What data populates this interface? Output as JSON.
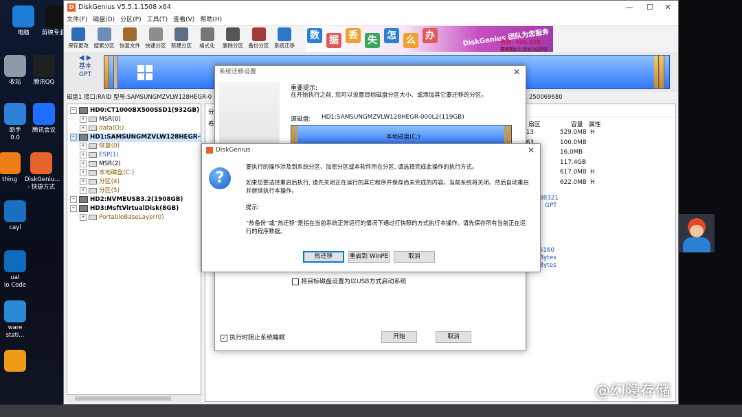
{
  "desktop": {
    "left_icons": [
      {
        "label": "电脑",
        "icon": "computer-icon",
        "color": "#1d7ed8"
      },
      {
        "label": "剪映专业版",
        "icon": "capcut-icon",
        "color": "#111111"
      },
      {
        "label": "收站",
        "icon": "recycle-bin-icon",
        "color": "#8f9aa8"
      },
      {
        "label": "腾讯QQ",
        "icon": "qq-icon",
        "color": "#202020"
      },
      {
        "label": "助手\n0.0",
        "icon": "assistant-icon",
        "color": "#2d7fd9"
      },
      {
        "label": "腾讯会议",
        "icon": "tencent-meeting-icon",
        "color": "#1e6fff"
      },
      {
        "label": "thing",
        "icon": "everything-icon",
        "color": "#f07c18"
      },
      {
        "label": "DiskGeniu...\n- 快捷方式",
        "icon": "diskgenius-icon",
        "color": "#e8632b"
      },
      {
        "label": "cayl",
        "icon": "app-icon",
        "color": "#1b6fc2"
      },
      {
        "label": "ual\nio Code",
        "icon": "vscode-icon",
        "color": "#0f6cbd"
      },
      {
        "label": "ware\nstati...",
        "icon": "vmware-icon",
        "color": "#2a8ad6"
      },
      {
        "label": "",
        "icon": "folder-icon",
        "color": "#f09a19"
      }
    ]
  },
  "app": {
    "title": "DiskGenius V5.5.1.1508 x64",
    "logo": "D",
    "window_controls": {
      "minimize": "—",
      "maximize": "☐",
      "close": "✕"
    },
    "menu": [
      "文件(F)",
      "磁盘(D)",
      "分区(P)",
      "工具(T)",
      "查看(V)",
      "帮助(H)"
    ],
    "toolbar": [
      {
        "label": "保存更改",
        "color": "#2f6db5"
      },
      {
        "label": "搜索分区",
        "color": "#6b8fb9"
      },
      {
        "label": "恢复文件",
        "color": "#a36b2b"
      },
      {
        "label": "快速分区",
        "color": "#8d8d8d"
      },
      {
        "label": "新建分区",
        "color": "#5c6f85"
      },
      {
        "label": "格式化",
        "color": "#777777"
      },
      {
        "label": "删除分区",
        "color": "#555555"
      },
      {
        "label": "备份分区",
        "color": "#a33a3a"
      },
      {
        "label": "系统迁移",
        "color": "#2b77c9"
      }
    ],
    "banner": {
      "chars": [
        {
          "t": "数",
          "color": "#2a7fd6"
        },
        {
          "t": "据",
          "color": "#e05a5a"
        },
        {
          "t": "丢",
          "color": "#f0a030"
        },
        {
          "t": "失",
          "color": "#3ba55c"
        },
        {
          "t": "怎",
          "color": "#2a7fd6"
        },
        {
          "t": "么",
          "color": "#f0a030"
        },
        {
          "t": "办",
          "color": "#e05a5a"
        }
      ],
      "slogan": "DiskGenius 团队为您服务",
      "phone": "咨询: 400-008-9958",
      "qq": "或点击此处添加QQ咨询"
    },
    "disk_map": {
      "scheme_line1": "基本",
      "scheme_line2": "GPT"
    },
    "disk_info": "磁盘1 接口:RAID 型号:SAMSUNGMZVLW128HEGR-0",
    "disk_info_tail": "250069680",
    "tree": [
      {
        "type": "disk",
        "label": "HD0:CT1000BX500SSD1(932GB)",
        "indent": 0,
        "bold": true,
        "color": "#000000"
      },
      {
        "type": "part",
        "label": "MSR(0)",
        "indent": 1,
        "bold": false,
        "color": "#000000"
      },
      {
        "type": "part",
        "label": "data(D:)",
        "indent": 1,
        "bold": false,
        "color": "#8b5a00"
      },
      {
        "type": "disk",
        "label": "HD1:SAMSUNGMZVLW128HEGR-000L",
        "indent": 0,
        "bold": true,
        "color": "#000000",
        "selected": true
      },
      {
        "type": "part",
        "label": "恢复(0)",
        "indent": 1,
        "bold": false,
        "color": "#8b5a00"
      },
      {
        "type": "part",
        "label": "ESP(1)",
        "indent": 1,
        "bold": false,
        "color": "#1f5fbf"
      },
      {
        "type": "part",
        "label": "MSR(2)",
        "indent": 1,
        "bold": false,
        "color": "#000000"
      },
      {
        "type": "part",
        "label": "本地磁盘(C:)",
        "indent": 1,
        "bold": false,
        "color": "#8b5a00"
      },
      {
        "type": "part",
        "label": "分区(4)",
        "indent": 1,
        "bold": false,
        "color": "#8b5a00"
      },
      {
        "type": "part",
        "label": "分区(5)",
        "indent": 1,
        "bold": false,
        "color": "#8b5a00"
      },
      {
        "type": "disk",
        "label": "HD2:NVMEUSB3.2(1908GB)",
        "indent": 0,
        "bold": true,
        "color": "#000000"
      },
      {
        "type": "disk",
        "label": "HD3:MsftVirtualDisk(8GB)",
        "indent": 0,
        "bold": true,
        "color": "#000000"
      },
      {
        "type": "part",
        "label": "PortableBaseLayer(0)",
        "indent": 1,
        "bold": false,
        "color": "#8b5a00"
      }
    ],
    "right_panel": {
      "tab_partial1": "分",
      "tab_partial2": "卷",
      "headers": {
        "sector": "扇区",
        "size": "容量",
        "attr": "属性"
      },
      "rows": [
        {
          "sector": "13",
          "size": "529.0MB",
          "attr": "H"
        },
        {
          "sector": "63",
          "size": "100.0MB",
          "attr": ""
        },
        {
          "sector": "8",
          "size": "16.0MB",
          "attr": ""
        },
        {
          "sector": "27",
          "size": "117.4GB",
          "attr": ""
        },
        {
          "sector": "8",
          "size": "617.0MB",
          "attr": "H"
        },
        {
          "sector": "36",
          "size": "622.0MB",
          "attr": "H"
        }
      ],
      "frag1": "38321",
      "frag2": "GPT",
      "frag3": "76160",
      "frag4": "Bytes",
      "frag5": "Bytes"
    }
  },
  "migrate_dialog": {
    "title": "系统迁移设置",
    "notice_title": "重要提示:",
    "notice_text": "在开始执行之前, 您可以设置目标磁盘分区大小、或添加其它要迁移的分区。",
    "source_label": "源磁盘:",
    "source_value": "HD1:SAMSUNGMZVLW128HEGR-000L2(119GB)",
    "source_part": "本地磁盘(C:)",
    "usb_option": "将目标磁盘设置为以USB方式启动系统",
    "sleep_option": "执行时阻止系统睡眠",
    "sleep_checked": "✓",
    "start_button": "开始",
    "cancel_button": "取消"
  },
  "confirm_dialog": {
    "title": "DiskGenius",
    "line1": "要执行的操作涉及到系统分区、加密分区或本软件所在分区, 请选择完成此操作的执行方式。",
    "line2": "如果您要选择重启后执行, 请先关闭正在运行的其它程序并保存尚未完成的内容。当前系统将关闭、然后自动重启并继续执行本操作。",
    "hint_title": "提示:",
    "line3": "“热备份”或“热迁移”是指在当前系统正常运行的情况下通过打快照的方式执行本操作。请先保存所有当前正在运行的程序数据。",
    "btn_hot": "热迁移",
    "btn_winpe": "重启到 WinPE",
    "btn_cancel": "取消"
  },
  "watermark": "@幻隐存储"
}
